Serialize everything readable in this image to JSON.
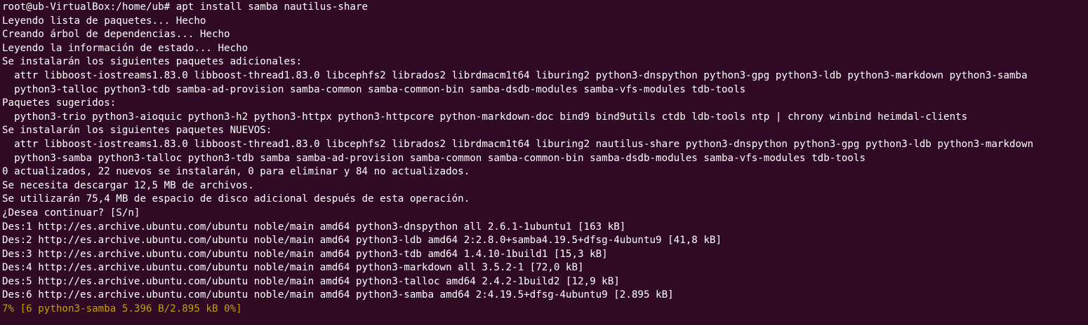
{
  "terminal": {
    "lines": [
      "root@ub-VirtualBox:/home/ub# apt install samba nautilus-share",
      "Leyendo lista de paquetes... Hecho",
      "Creando árbol de dependencias... Hecho",
      "Leyendo la información de estado... Hecho",
      "Se instalarán los siguientes paquetes adicionales:",
      "  attr libboost-iostreams1.83.0 libboost-thread1.83.0 libcephfs2 librados2 librdmacm1t64 liburing2 python3-dnspython python3-gpg python3-ldb python3-markdown python3-samba",
      "  python3-talloc python3-tdb samba-ad-provision samba-common samba-common-bin samba-dsdb-modules samba-vfs-modules tdb-tools",
      "Paquetes sugeridos:",
      "  python3-trio python3-aioquic python3-h2 python3-httpx python3-httpcore python-markdown-doc bind9 bind9utils ctdb ldb-tools ntp | chrony winbind heimdal-clients",
      "Se instalarán los siguientes paquetes NUEVOS:",
      "  attr libboost-iostreams1.83.0 libboost-thread1.83.0 libcephfs2 librados2 librdmacm1t64 liburing2 nautilus-share python3-dnspython python3-gpg python3-ldb python3-markdown",
      "  python3-samba python3-talloc python3-tdb samba samba-ad-provision samba-common samba-common-bin samba-dsdb-modules samba-vfs-modules tdb-tools",
      "0 actualizados, 22 nuevos se instalarán, 0 para eliminar y 84 no actualizados.",
      "Se necesita descargar 12,5 MB de archivos.",
      "Se utilizarán 75,4 MB de espacio de disco adicional después de esta operación.",
      "¿Desea continuar? [S/n]",
      "Des:1 http://es.archive.ubuntu.com/ubuntu noble/main amd64 python3-dnspython all 2.6.1-1ubuntu1 [163 kB]",
      "Des:2 http://es.archive.ubuntu.com/ubuntu noble/main amd64 python3-ldb amd64 2:2.8.0+samba4.19.5+dfsg-4ubuntu9 [41,8 kB]",
      "Des:3 http://es.archive.ubuntu.com/ubuntu noble/main amd64 python3-tdb amd64 1.4.10-1build1 [15,3 kB]",
      "Des:4 http://es.archive.ubuntu.com/ubuntu noble/main amd64 python3-markdown all 3.5.2-1 [72,0 kB]",
      "Des:5 http://es.archive.ubuntu.com/ubuntu noble/main amd64 python3-talloc amd64 2.4.2-1build2 [12,9 kB]",
      "Des:6 http://es.archive.ubuntu.com/ubuntu noble/main amd64 python3-samba amd64 2:4.19.5+dfsg-4ubuntu9 [2.895 kB]"
    ],
    "progress_line": "7% [6 python3-samba 5.396 B/2.895 kB 0%]",
    "colors": {
      "background": "#300a24",
      "text": "#ffffff",
      "progress": "#c4a000"
    }
  }
}
